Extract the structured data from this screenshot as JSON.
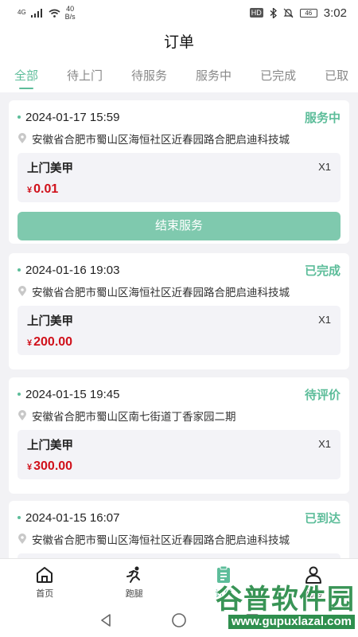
{
  "status_bar": {
    "network": "4G",
    "speed_value": "40",
    "speed_unit": "B/s",
    "hd": "HD",
    "battery": "46",
    "time": "3:02"
  },
  "header": {
    "title": "订单"
  },
  "tabs": [
    {
      "label": "全部",
      "active": true
    },
    {
      "label": "待上门"
    },
    {
      "label": "待服务"
    },
    {
      "label": "服务中"
    },
    {
      "label": "已完成"
    },
    {
      "label": "已取"
    }
  ],
  "orders": [
    {
      "date": "2024-01-17 15:59",
      "status": "服务中",
      "address": "安徽省合肥市蜀山区海恒社区近春园路合肥启迪科技城",
      "item_name": "上门美甲",
      "quantity": "X1",
      "currency": "¥",
      "price": "0.01",
      "action_label": "结束服务"
    },
    {
      "date": "2024-01-16 19:03",
      "status": "已完成",
      "address": "安徽省合肥市蜀山区海恒社区近春园路合肥启迪科技城",
      "item_name": "上门美甲",
      "quantity": "X1",
      "currency": "¥",
      "price": "200.00"
    },
    {
      "date": "2024-01-15 19:45",
      "status": "待评价",
      "address": "安徽省合肥市蜀山区南七街道丁香家园二期",
      "item_name": "上门美甲",
      "quantity": "X1",
      "currency": "¥",
      "price": "300.00"
    },
    {
      "date": "2024-01-15 16:07",
      "status": "已到达",
      "address": "安徽省合肥市蜀山区海恒社区近春园路合肥启迪科技城"
    }
  ],
  "tab_bar": [
    {
      "label": "首页",
      "icon": "home-icon"
    },
    {
      "label": "跑腿",
      "icon": "runner-icon"
    },
    {
      "label": "订单",
      "icon": "clipboard-icon",
      "active": true
    },
    {
      "label": "我的",
      "icon": "user-icon"
    }
  ],
  "watermark": {
    "main": "谷普软件园",
    "sub": "www.gupuxlazal.com"
  },
  "colors": {
    "accent": "#5dbd9a",
    "price": "#d0111b",
    "button": "#7fc9ae"
  }
}
